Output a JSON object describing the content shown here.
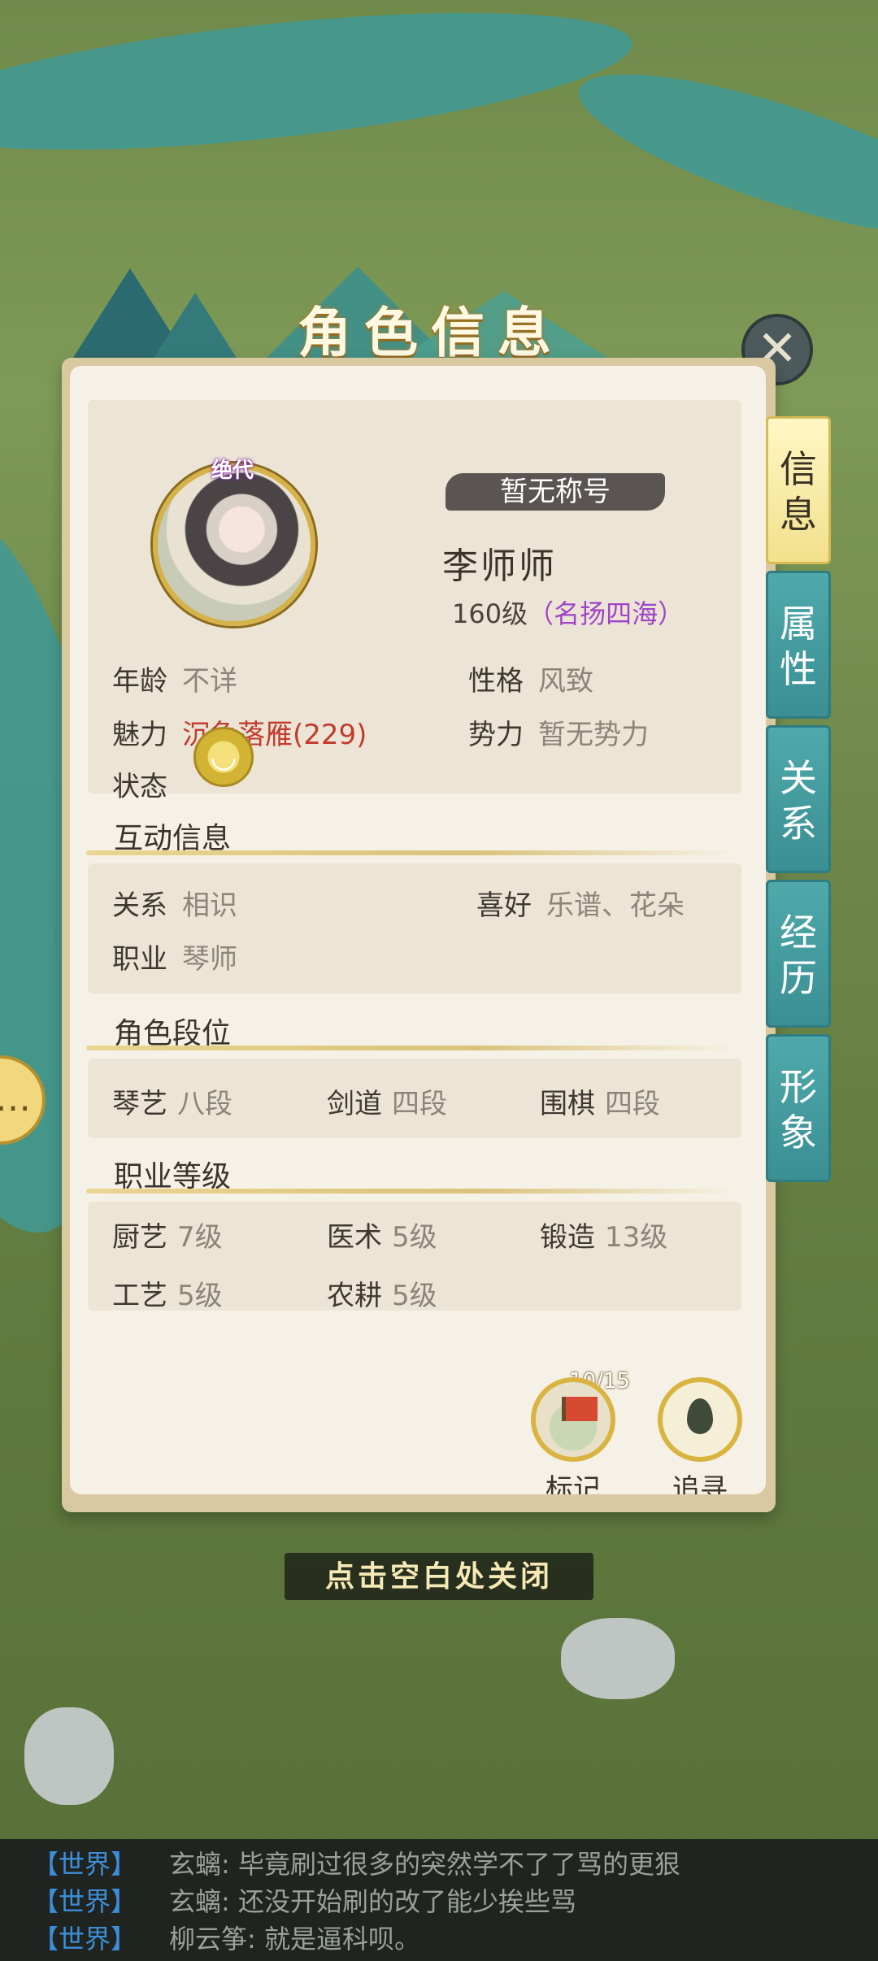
{
  "header": {
    "title": "角色信息"
  },
  "profile": {
    "grade": "绝代",
    "title_badge": "暂无称号",
    "name": "李师师",
    "level": "160级",
    "fame": "（名扬四海）",
    "attributes": [
      {
        "key": "年龄",
        "value": "不详"
      },
      {
        "key": "性格",
        "value": "风致"
      },
      {
        "key": "魅力",
        "value": "沉鱼落雁(229)"
      },
      {
        "key": "势力",
        "value": "暂无势力"
      }
    ],
    "status_label": "状态",
    "status_icon": "bowl-icon"
  },
  "interaction": {
    "title": "互动信息",
    "items": [
      {
        "key": "关系",
        "value": "相识"
      },
      {
        "key": "喜好",
        "value": "乐谱、花朵"
      },
      {
        "key": "职业",
        "value": "琴师"
      }
    ]
  },
  "ranks": {
    "title": "角色段位",
    "items": [
      {
        "key": "琴艺",
        "value": "八段"
      },
      {
        "key": "剑道",
        "value": "四段"
      },
      {
        "key": "围棋",
        "value": "四段"
      }
    ]
  },
  "skills": {
    "title": "职业等级",
    "items": [
      {
        "key": "厨艺",
        "value": "7级"
      },
      {
        "key": "医术",
        "value": "5级"
      },
      {
        "key": "锻造",
        "value": "13级"
      },
      {
        "key": "工艺",
        "value": "5级"
      },
      {
        "key": "农耕",
        "value": "5级"
      }
    ]
  },
  "side_tabs": [
    {
      "label_top": "信",
      "label_bottom": "息",
      "active": true
    },
    {
      "label_top": "属",
      "label_bottom": "性",
      "active": false
    },
    {
      "label_top": "关",
      "label_bottom": "系",
      "active": false
    },
    {
      "label_top": "经",
      "label_bottom": "历",
      "active": false
    },
    {
      "label_top": "形",
      "label_bottom": "象",
      "active": false
    }
  ],
  "actions": {
    "mark_counter": "10/15",
    "mark_label": "标记",
    "track_label": "追寻"
  },
  "close_hint": "点击空白处关闭",
  "close_icon": "close-x-icon",
  "chat": [
    {
      "channel": "【世界】",
      "who": "玄螭",
      "msg": ": 毕竟刷过很多的突然学不了了骂的更狠"
    },
    {
      "channel": "【世界】",
      "who": "玄螭",
      "msg": ": 还没开始刷的改了能少挨些骂"
    },
    {
      "channel": "【世界】",
      "who": "柳云筝",
      "msg": ": 就是逼科呗。"
    }
  ],
  "colors": {
    "accent_gold": "#d6b24a",
    "tab_teal": "#3a8f93",
    "charm_red": "#c23b2e",
    "fame_purple": "#a044c9",
    "chat_channel_blue": "#3d8ed8"
  }
}
